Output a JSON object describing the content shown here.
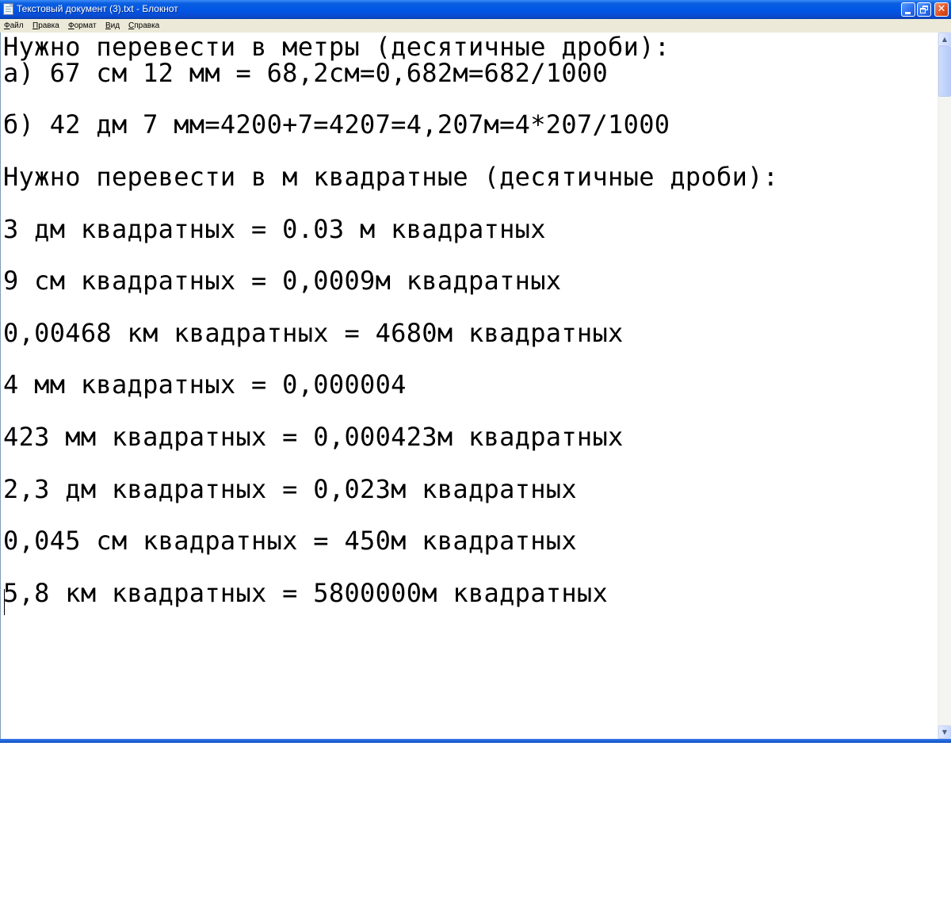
{
  "window": {
    "title": "Текстовый документ (3).txt - Блокнот",
    "title_color": "#0055e5"
  },
  "menu": {
    "items": [
      "Файл",
      "Правка",
      "Формат",
      "Вид",
      "Справка"
    ]
  },
  "editor": {
    "lines": [
      "Нужно перевести в метры (десятичные дроби):",
      "а) 67 см 12 мм = 68,2см=0,682м=682/1000",
      "",
      "б) 42 дм 7 мм=4200+7=4207=4,207м=4*207/1000",
      "",
      "Нужно перевести в м квадратные (десятичные дроби):",
      "",
      "3 дм квадратных = 0.03 м квадратных",
      "",
      "9 см квадратных = 0,0009м квадратных",
      "",
      "0,00468 км квадратных = 4680м квадратных",
      "",
      "4 мм квадратных = 0,000004",
      "",
      "423 мм квадратных = 0,000423м квадратных",
      "",
      "2,3 дм квадратных = 0,023м квадратных",
      "",
      "0,045 см квадратных = 450м квадратных",
      "",
      "5,8 км квадратных = 5800000м квадратных"
    ]
  },
  "icons": {
    "app": "notepad-icon",
    "minimize": "minimize-icon",
    "maximize": "restore-icon",
    "close": "close-icon"
  }
}
